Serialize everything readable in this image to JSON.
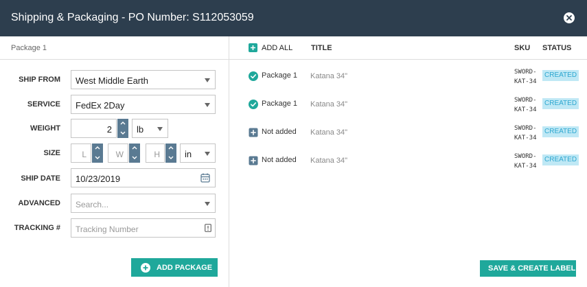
{
  "dialog": {
    "title": "Shipping & Packaging - PO Number: S112053059"
  },
  "left_panel": {
    "package_tab": "Package 1",
    "ship_from": {
      "label": "SHIP FROM",
      "value": "West Middle Earth"
    },
    "service": {
      "label": "SERVICE",
      "value": "FedEx 2Day"
    },
    "weight": {
      "label": "WEIGHT",
      "value": "2",
      "unit": "lb"
    },
    "size": {
      "label": "SIZE",
      "l_placeholder": "L",
      "w_placeholder": "W",
      "h_placeholder": "H",
      "unit": "in"
    },
    "ship_date": {
      "label": "SHIP DATE",
      "value": "10/23/2019"
    },
    "advanced": {
      "label": "ADVANCED",
      "placeholder": "Search..."
    },
    "tracking": {
      "label": "TRACKING #",
      "placeholder": "Tracking Number"
    },
    "add_package_label": "ADD PACKAGE"
  },
  "right_panel": {
    "columns": {
      "add_all": "ADD ALL",
      "title": "TITLE",
      "sku": "SKU",
      "status": "STATUS"
    },
    "rows": [
      {
        "state": "added",
        "state_label": "Package 1",
        "title": "Katana 34\"",
        "sku": "SWORD-KAT-34",
        "status": "CREATED"
      },
      {
        "state": "added",
        "state_label": "Package 1",
        "title": "Katana 34\"",
        "sku": "SWORD-KAT-34",
        "status": "CREATED"
      },
      {
        "state": "not_added",
        "state_label": "Not added",
        "title": "Katana 34\"",
        "sku": "SWORD-KAT-34",
        "status": "CREATED"
      },
      {
        "state": "not_added",
        "state_label": "Not added",
        "title": "Katana 34\"",
        "sku": "SWORD-KAT-34",
        "status": "CREATED"
      }
    ],
    "save_label": "SAVE & CREATE LABEL"
  },
  "colors": {
    "header_bg": "#2d3e4e",
    "accent": "#1fa89b",
    "spinner": "#5a7a92",
    "status_bg": "#bfe8f5",
    "status_text": "#2da7d0"
  }
}
